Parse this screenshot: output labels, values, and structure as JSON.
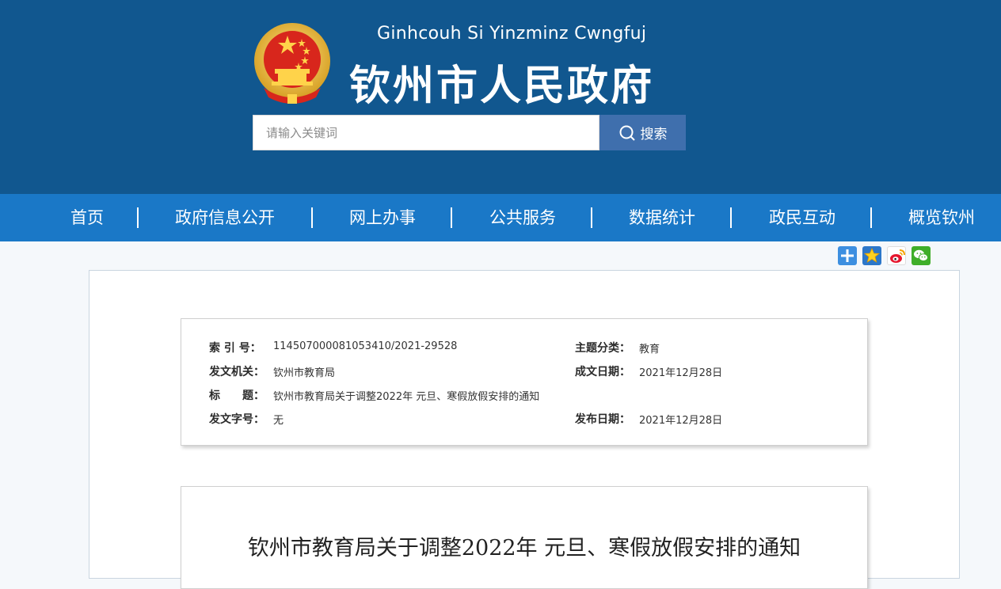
{
  "header": {
    "subtitle": "Ginhcouh Si Yinzminz Cwngfuj",
    "title": "钦州市人民政府",
    "emblem_icon": "national-emblem-icon",
    "colors": {
      "background": "#11578f",
      "search_button": "#3f6fad"
    }
  },
  "search": {
    "placeholder": "请输入关键词",
    "value": "",
    "button_label": "搜索",
    "icon": "search-icon"
  },
  "nav": {
    "color": "#1a78c7",
    "items": [
      {
        "label": "首页"
      },
      {
        "label": "政府信息公开"
      },
      {
        "label": "网上办事"
      },
      {
        "label": "公共服务"
      },
      {
        "label": "数据统计"
      },
      {
        "label": "政民互动"
      },
      {
        "label": "概览钦州"
      }
    ]
  },
  "share": {
    "icons": [
      "share-plus-icon",
      "qzone-star-icon",
      "weibo-icon",
      "wechat-icon"
    ]
  },
  "meta": {
    "index_label": "索 引 号：",
    "index_value": "114507000081053410/2021-29528",
    "topic_label": "主题分类：",
    "topic_value": "教育",
    "issuer_label": "发文机关：",
    "issuer_value": "钦州市教育局",
    "created_label": "成文日期：",
    "created_value": "2021年12月28日",
    "title_label": "标　　题：",
    "title_value": "钦州市教育局关于调整2022年 元旦、寒假放假安排的通知",
    "docno_label": "发文字号：",
    "docno_value": "无",
    "published_label": "发布日期：",
    "published_value": "2021年12月28日"
  },
  "article": {
    "title": "钦州市教育局关于调整2022年 元旦、寒假放假安排的通知"
  }
}
